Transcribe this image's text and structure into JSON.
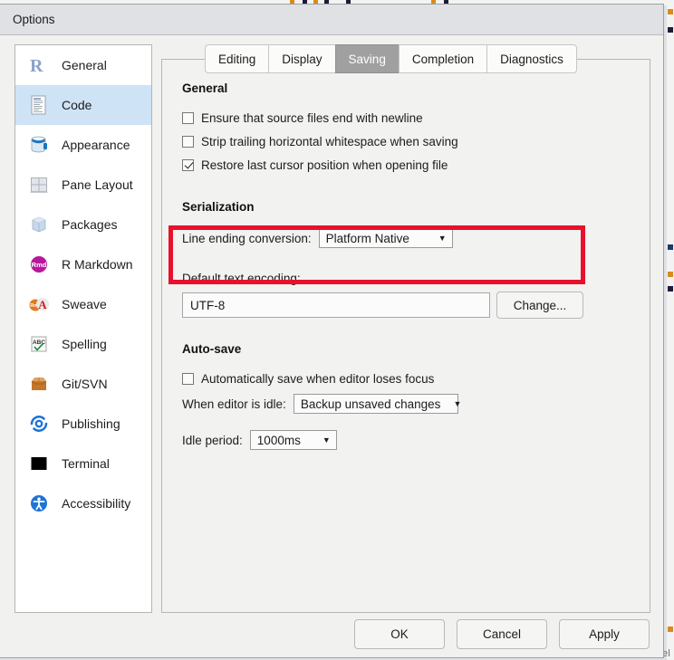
{
  "window": {
    "title": "Options"
  },
  "sidebar": {
    "items": [
      {
        "label": "General",
        "icon": "r-logo-icon",
        "selected": false
      },
      {
        "label": "Code",
        "icon": "document-icon",
        "selected": true
      },
      {
        "label": "Appearance",
        "icon": "paint-can-icon",
        "selected": false
      },
      {
        "label": "Pane Layout",
        "icon": "grid-panes-icon",
        "selected": false
      },
      {
        "label": "Packages",
        "icon": "box-cube-icon",
        "selected": false
      },
      {
        "label": "R Markdown",
        "icon": "rmd-badge-icon",
        "selected": false
      },
      {
        "label": "Sweave",
        "icon": "pdf-rnw-icon",
        "selected": false
      },
      {
        "label": "Spelling",
        "icon": "abc-check-icon",
        "selected": false
      },
      {
        "label": "Git/SVN",
        "icon": "open-box-icon",
        "selected": false
      },
      {
        "label": "Publishing",
        "icon": "publish-icon",
        "selected": false
      },
      {
        "label": "Terminal",
        "icon": "terminal-icon",
        "selected": false
      },
      {
        "label": "Accessibility",
        "icon": "accessibility-icon",
        "selected": false
      }
    ]
  },
  "tabs": [
    {
      "label": "Editing",
      "active": false
    },
    {
      "label": "Display",
      "active": false
    },
    {
      "label": "Saving",
      "active": true
    },
    {
      "label": "Completion",
      "active": false
    },
    {
      "label": "Diagnostics",
      "active": false
    }
  ],
  "general": {
    "heading": "General",
    "options": [
      {
        "label": "Ensure that source files end with newline",
        "checked": false
      },
      {
        "label": "Strip trailing horizontal whitespace when saving",
        "checked": false
      },
      {
        "label": "Restore last cursor position when opening file",
        "checked": true
      }
    ]
  },
  "serialization": {
    "heading": "Serialization",
    "line_ending_label": "Line ending conversion:",
    "line_ending_value": "Platform Native",
    "encoding_label": "Default text encoding:",
    "encoding_value": "UTF-8",
    "change_button": "Change..."
  },
  "autosave": {
    "heading": "Auto-save",
    "auto_save_focus": {
      "label": "Automatically save when editor loses focus",
      "checked": false
    },
    "idle_action_label": "When editor is idle:",
    "idle_action_value": "Backup unsaved changes",
    "idle_period_label": "Idle period:",
    "idle_period_value": "1000ms"
  },
  "footer": {
    "ok": "OK",
    "cancel": "Cancel",
    "apply": "Apply"
  },
  "background": {
    "partial_text": "Model"
  },
  "colors": {
    "highlight": "#e8112d",
    "selection": "#cfe3f7",
    "active_tab": "#a0a0a0",
    "titlebar": "#dfe1e5",
    "panel": "#f2f2f0"
  }
}
